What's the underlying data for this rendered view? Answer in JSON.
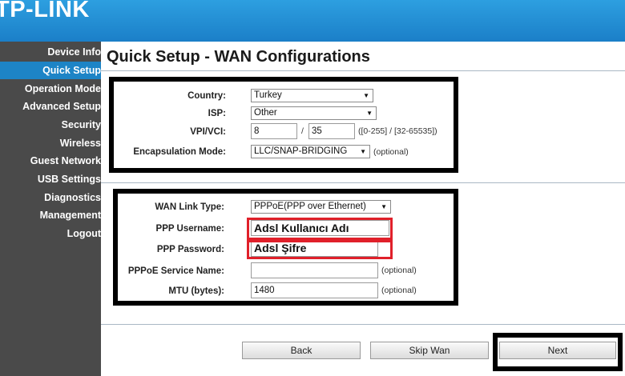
{
  "brand": {
    "logo_text": "TP-LINK"
  },
  "sidebar": {
    "items": [
      {
        "label": "Device Info"
      },
      {
        "label": "Quick Setup"
      },
      {
        "label": "Operation Mode"
      },
      {
        "label": "Advanced Setup"
      },
      {
        "label": "Security"
      },
      {
        "label": "Wireless"
      },
      {
        "label": "Guest Network"
      },
      {
        "label": "USB Settings"
      },
      {
        "label": "Diagnostics"
      },
      {
        "label": "Management"
      },
      {
        "label": "Logout"
      }
    ]
  },
  "page": {
    "title": "Quick Setup - WAN Configurations"
  },
  "atm": {
    "country_label": "Country:",
    "country_value": "Turkey",
    "isp_label": "ISP:",
    "isp_value": "Other",
    "vpivci_label": "VPI/VCI:",
    "vpi_value": "8",
    "separator": "/",
    "vci_value": "35",
    "vpivci_hint": "([0-255] / [32-65535])",
    "encap_label": "Encapsulation Mode:",
    "encap_value": "LLC/SNAP-BRIDGING",
    "optional": "(optional)"
  },
  "wan": {
    "link_type_label": "WAN Link Type:",
    "link_type_value": "PPPoE(PPP over Ethernet)",
    "username_label": "PPP Username:",
    "username_value": "Adsl Kullanıcı Adı",
    "password_label": "PPP Password:",
    "password_value": "Adsl Şifre",
    "service_label": "PPPoE Service Name:",
    "service_value": "",
    "service_optional": "(optional)",
    "mtu_label": "MTU (bytes):",
    "mtu_value": "1480",
    "mtu_optional": "(optional)"
  },
  "buttons": {
    "back": "Back",
    "skip": "Skip Wan",
    "next": "Next"
  },
  "colors": {
    "header": "#1b7fc8",
    "sidebar": "#4a4a4a",
    "active": "#1d84c6",
    "highlight_red": "#e0202a"
  }
}
